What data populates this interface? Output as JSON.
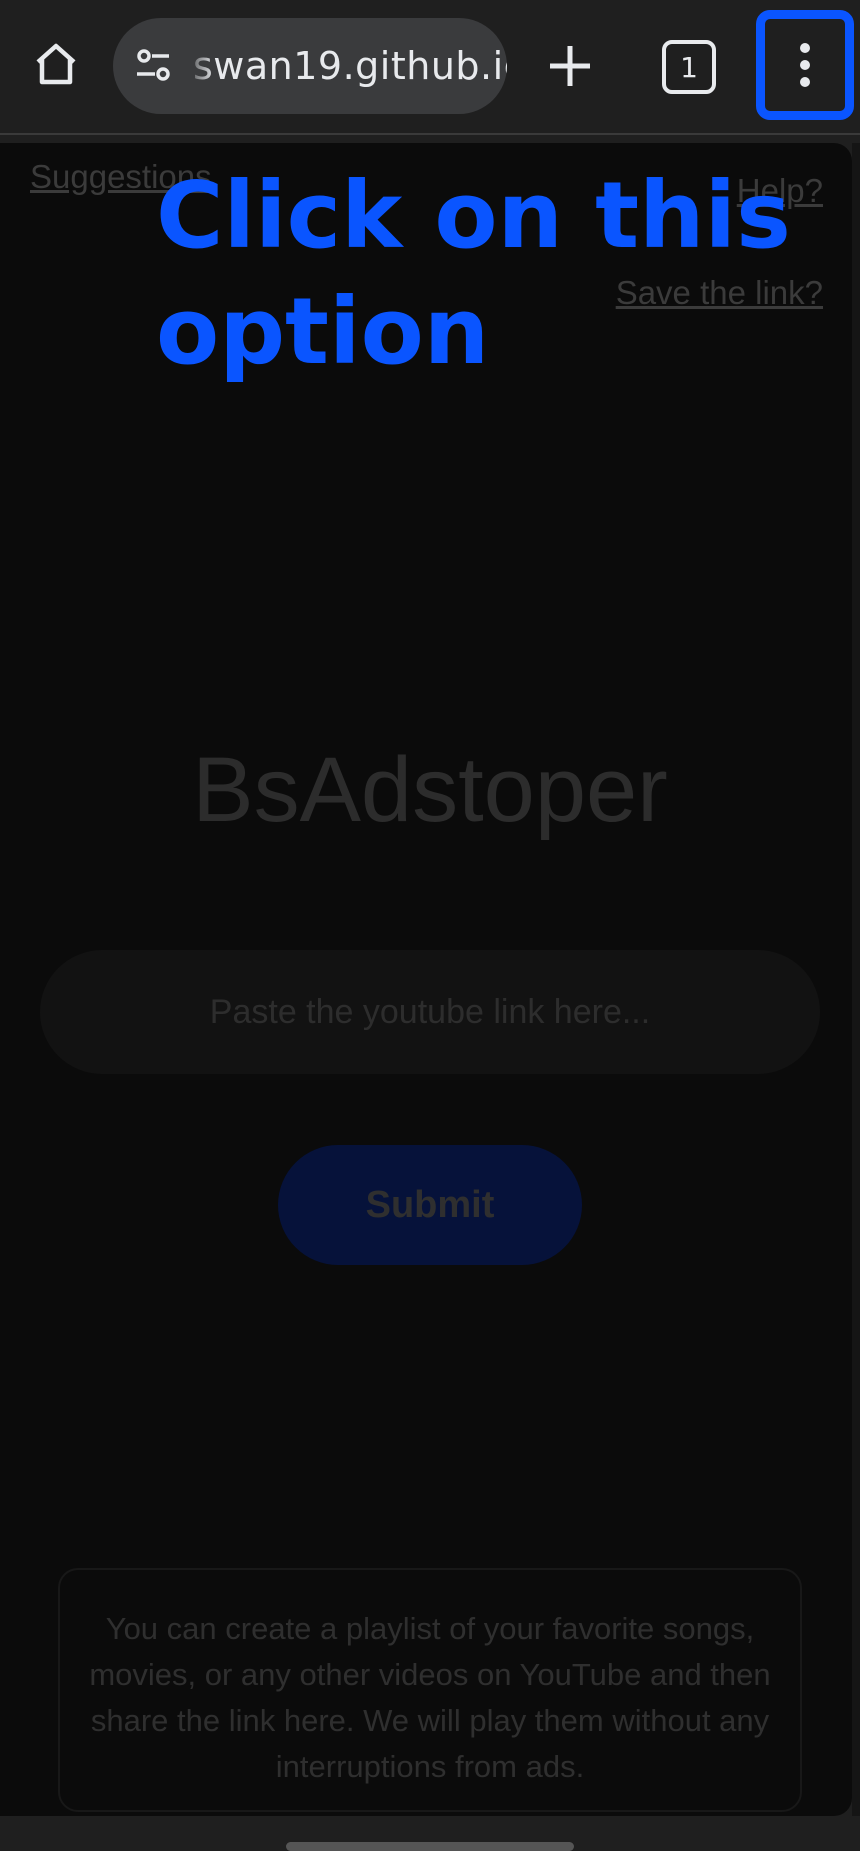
{
  "browser": {
    "url": "swan19.github.io",
    "tab_count": "1",
    "icons": [
      "home-icon",
      "site-settings-icon",
      "plus-icon",
      "tab-switcher-icon",
      "more-options-icon"
    ],
    "highlight_color": "#0a55ff"
  },
  "page": {
    "suggestions_link": "Suggestions",
    "help_link": "Help?",
    "save_link": "Save the link?",
    "brand": "BsAdstoper",
    "input_placeholder": "Paste the youtube link here...",
    "submit_label": "Submit",
    "info_text": "You can create a playlist of your favorite songs, movies, or any other videos on YouTube and then share the link here. We will play them without any interruptions from ads."
  },
  "overlay": {
    "instruction": "Click on this option"
  }
}
